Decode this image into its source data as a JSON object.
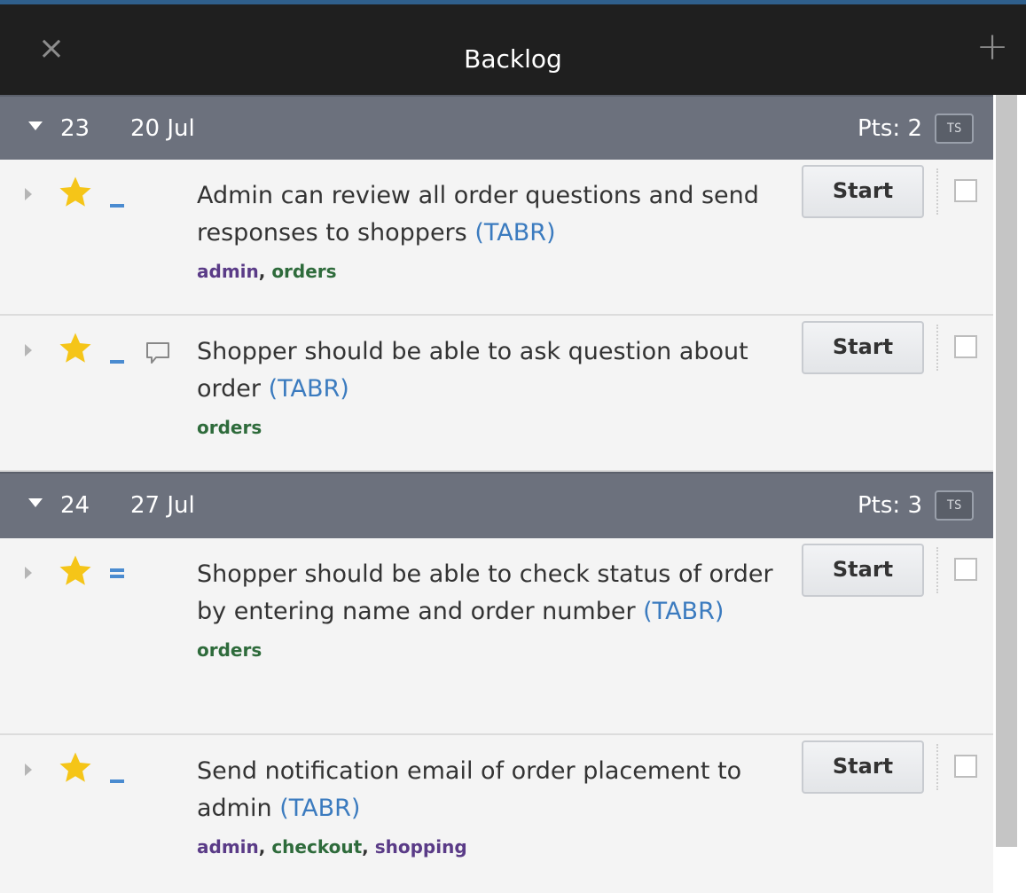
{
  "panel": {
    "title": "Backlog",
    "close_icon": "×",
    "add_icon": "+"
  },
  "iterations": [
    {
      "number": "23",
      "date": "20 Jul",
      "points": "Pts: 2",
      "ts_label": "TS",
      "stories": [
        {
          "title": "Admin can review all order questions and send responses to shoppers",
          "project": "(TABR)",
          "labels": [
            "admin",
            "orders"
          ],
          "start_label": "Start",
          "has_comment": false,
          "estimate": 1
        },
        {
          "title": "Shopper should be able to ask question about order",
          "project": "(TABR)",
          "labels": [
            "orders"
          ],
          "start_label": "Start",
          "has_comment": true,
          "estimate": 1
        }
      ]
    },
    {
      "number": "24",
      "date": "27 Jul",
      "points": "Pts: 3",
      "ts_label": "TS",
      "stories": [
        {
          "title": "Shopper should be able to check status of order by entering name and order number",
          "project": "(TABR)",
          "labels": [
            "orders"
          ],
          "start_label": "Start",
          "has_comment": false,
          "estimate": 2
        },
        {
          "title": "Send notification email of order placement to admin",
          "project": "(TABR)",
          "labels": [
            "admin",
            "checkout",
            "shopping"
          ],
          "start_label": "Start",
          "has_comment": false,
          "estimate": 1
        }
      ]
    }
  ],
  "colors": {
    "header_bg": "#1f1f1f",
    "iteration_bg": "#6c717d",
    "project_link": "#3b7bbf",
    "star": "#f5c518",
    "label_purple": "#5a3b87",
    "label_green": "#2e6b3b"
  }
}
